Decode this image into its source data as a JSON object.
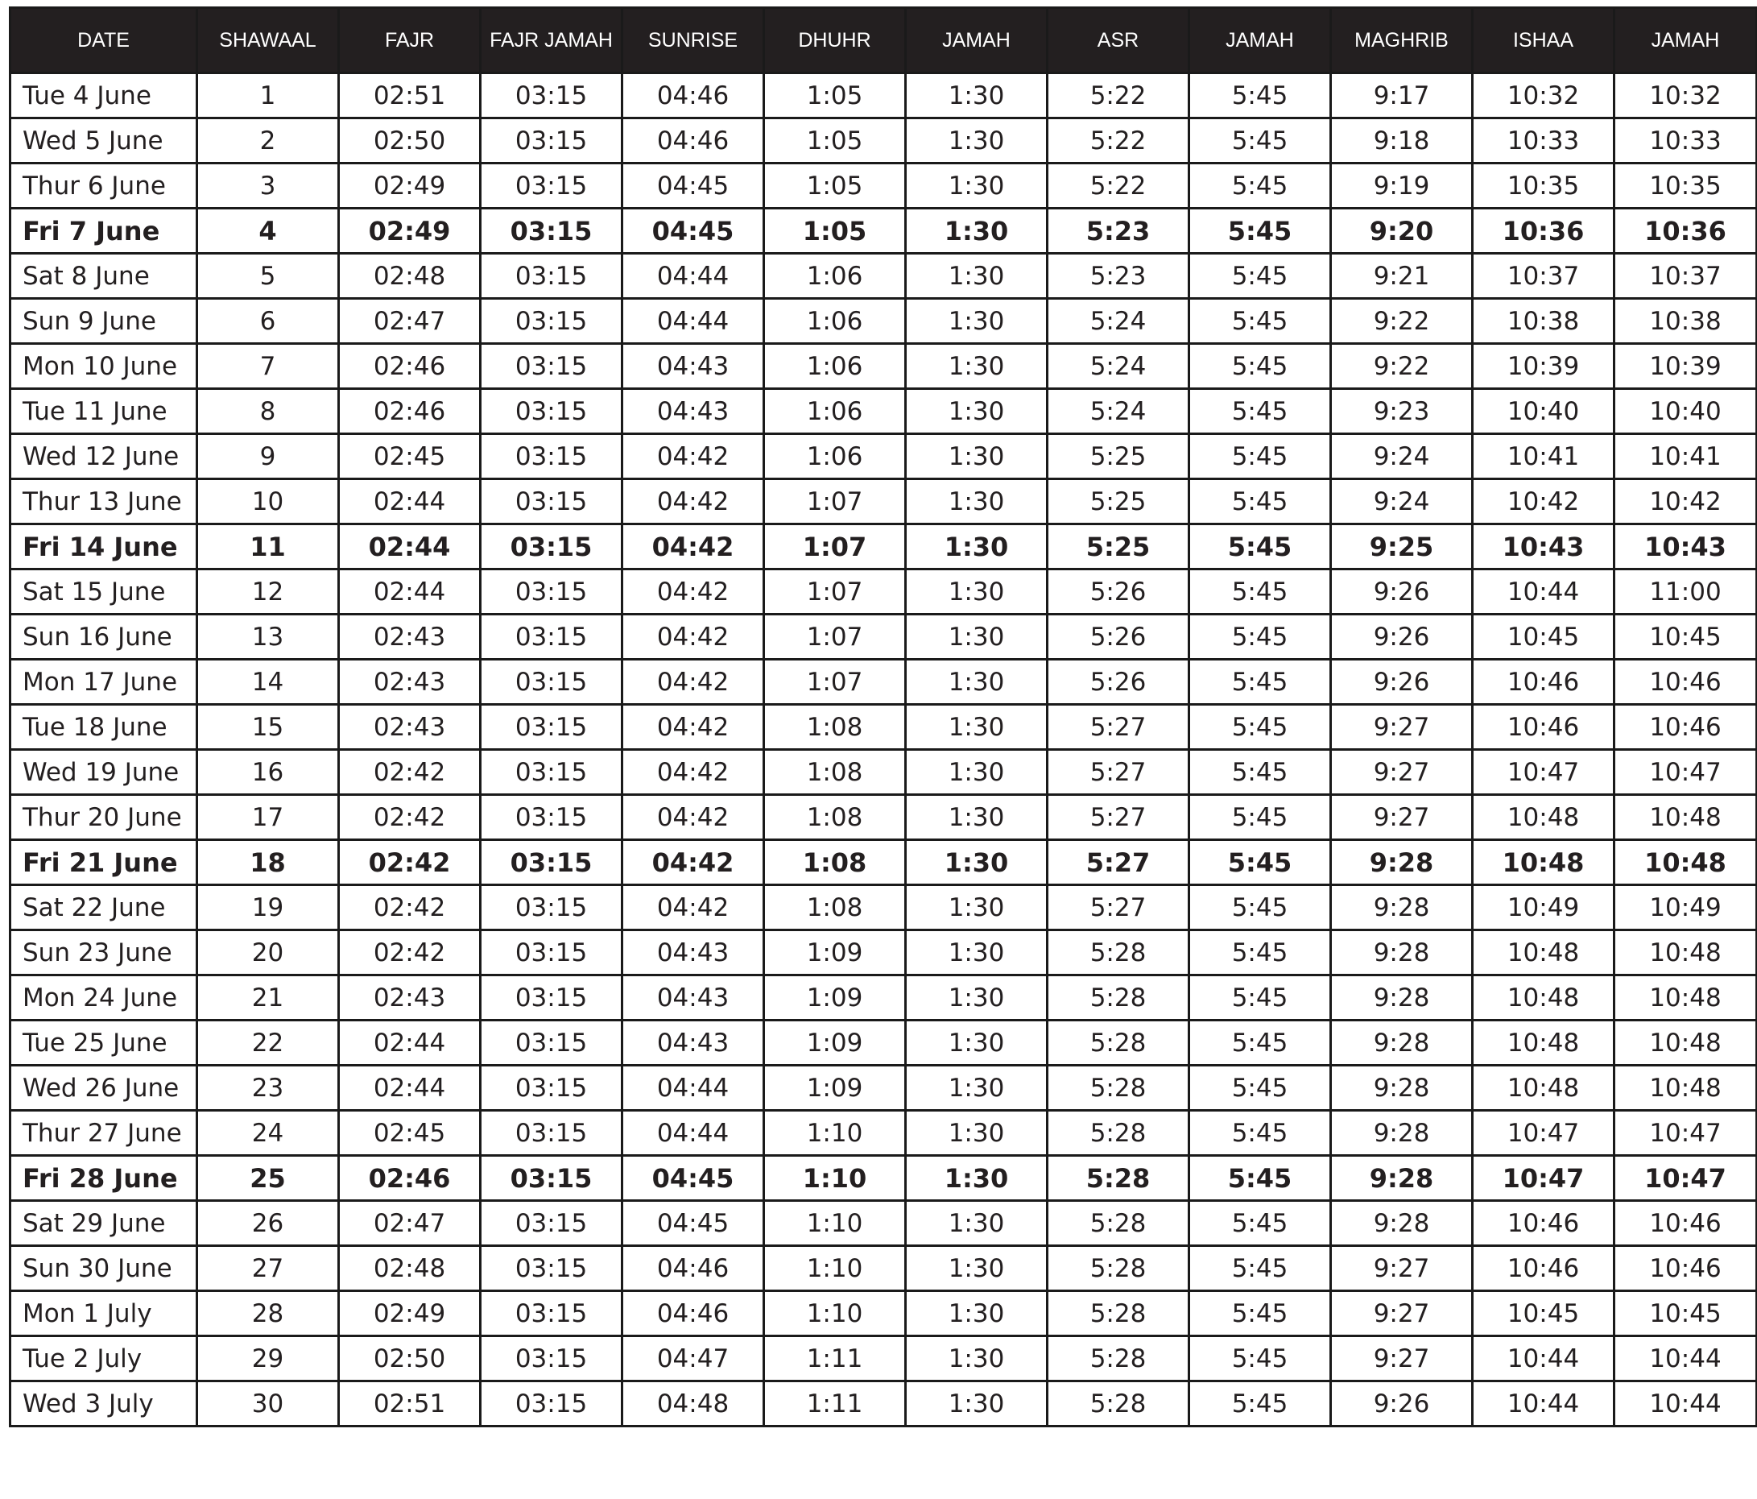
{
  "headers": [
    "DATE",
    "SHAWAAL",
    "FAJR",
    "FAJR JAMAH",
    "SUNRISE",
    "DHUHR",
    "JAMAH",
    "ASR",
    "JAMAH",
    "MAGHRIB",
    "ISHAA",
    "JAMAH"
  ],
  "rows": [
    {
      "date": "Tue 4 June",
      "shawaal": "1",
      "fajr": "02:51",
      "fajr_jamah": "03:15",
      "sunrise": "04:46",
      "dhuhr": "1:05",
      "dhuhr_jamah": "1:30",
      "asr": "5:22",
      "asr_jamah": "5:45",
      "maghrib": "9:17",
      "ishaa": "10:32",
      "ishaa_jamah": "10:32",
      "friday": false
    },
    {
      "date": "Wed 5 June",
      "shawaal": "2",
      "fajr": "02:50",
      "fajr_jamah": "03:15",
      "sunrise": "04:46",
      "dhuhr": "1:05",
      "dhuhr_jamah": "1:30",
      "asr": "5:22",
      "asr_jamah": "5:45",
      "maghrib": "9:18",
      "ishaa": "10:33",
      "ishaa_jamah": "10:33",
      "friday": false
    },
    {
      "date": "Thur 6 June",
      "shawaal": "3",
      "fajr": "02:49",
      "fajr_jamah": "03:15",
      "sunrise": "04:45",
      "dhuhr": "1:05",
      "dhuhr_jamah": "1:30",
      "asr": "5:22",
      "asr_jamah": "5:45",
      "maghrib": "9:19",
      "ishaa": "10:35",
      "ishaa_jamah": "10:35",
      "friday": false
    },
    {
      "date": "Fri 7 June",
      "shawaal": "4",
      "fajr": "02:49",
      "fajr_jamah": "03:15",
      "sunrise": "04:45",
      "dhuhr": "1:05",
      "dhuhr_jamah": "1:30",
      "asr": "5:23",
      "asr_jamah": "5:45",
      "maghrib": "9:20",
      "ishaa": "10:36",
      "ishaa_jamah": "10:36",
      "friday": true
    },
    {
      "date": "Sat 8 June",
      "shawaal": "5",
      "fajr": "02:48",
      "fajr_jamah": "03:15",
      "sunrise": "04:44",
      "dhuhr": "1:06",
      "dhuhr_jamah": "1:30",
      "asr": "5:23",
      "asr_jamah": "5:45",
      "maghrib": "9:21",
      "ishaa": "10:37",
      "ishaa_jamah": "10:37",
      "friday": false
    },
    {
      "date": "Sun 9 June",
      "shawaal": "6",
      "fajr": "02:47",
      "fajr_jamah": "03:15",
      "sunrise": "04:44",
      "dhuhr": "1:06",
      "dhuhr_jamah": "1:30",
      "asr": "5:24",
      "asr_jamah": "5:45",
      "maghrib": "9:22",
      "ishaa": "10:38",
      "ishaa_jamah": "10:38",
      "friday": false
    },
    {
      "date": "Mon 10 June",
      "shawaal": "7",
      "fajr": "02:46",
      "fajr_jamah": "03:15",
      "sunrise": "04:43",
      "dhuhr": "1:06",
      "dhuhr_jamah": "1:30",
      "asr": "5:24",
      "asr_jamah": "5:45",
      "maghrib": "9:22",
      "ishaa": "10:39",
      "ishaa_jamah": "10:39",
      "friday": false
    },
    {
      "date": "Tue 11 June",
      "shawaal": "8",
      "fajr": "02:46",
      "fajr_jamah": "03:15",
      "sunrise": "04:43",
      "dhuhr": "1:06",
      "dhuhr_jamah": "1:30",
      "asr": "5:24",
      "asr_jamah": "5:45",
      "maghrib": "9:23",
      "ishaa": "10:40",
      "ishaa_jamah": "10:40",
      "friday": false
    },
    {
      "date": "Wed 12 June",
      "shawaal": "9",
      "fajr": "02:45",
      "fajr_jamah": "03:15",
      "sunrise": "04:42",
      "dhuhr": "1:06",
      "dhuhr_jamah": "1:30",
      "asr": "5:25",
      "asr_jamah": "5:45",
      "maghrib": "9:24",
      "ishaa": "10:41",
      "ishaa_jamah": "10:41",
      "friday": false
    },
    {
      "date": "Thur 13 June",
      "shawaal": "10",
      "fajr": "02:44",
      "fajr_jamah": "03:15",
      "sunrise": "04:42",
      "dhuhr": "1:07",
      "dhuhr_jamah": "1:30",
      "asr": "5:25",
      "asr_jamah": "5:45",
      "maghrib": "9:24",
      "ishaa": "10:42",
      "ishaa_jamah": "10:42",
      "friday": false
    },
    {
      "date": "Fri 14 June",
      "shawaal": "11",
      "fajr": "02:44",
      "fajr_jamah": "03:15",
      "sunrise": "04:42",
      "dhuhr": "1:07",
      "dhuhr_jamah": "1:30",
      "asr": "5:25",
      "asr_jamah": "5:45",
      "maghrib": "9:25",
      "ishaa": "10:43",
      "ishaa_jamah": "10:43",
      "friday": true
    },
    {
      "date": "Sat 15 June",
      "shawaal": "12",
      "fajr": "02:44",
      "fajr_jamah": "03:15",
      "sunrise": "04:42",
      "dhuhr": "1:07",
      "dhuhr_jamah": "1:30",
      "asr": "5:26",
      "asr_jamah": "5:45",
      "maghrib": "9:26",
      "ishaa": "10:44",
      "ishaa_jamah": "11:00",
      "friday": false
    },
    {
      "date": "Sun 16 June",
      "shawaal": "13",
      "fajr": "02:43",
      "fajr_jamah": "03:15",
      "sunrise": "04:42",
      "dhuhr": "1:07",
      "dhuhr_jamah": "1:30",
      "asr": "5:26",
      "asr_jamah": "5:45",
      "maghrib": "9:26",
      "ishaa": "10:45",
      "ishaa_jamah": "10:45",
      "friday": false
    },
    {
      "date": "Mon 17 June",
      "shawaal": "14",
      "fajr": "02:43",
      "fajr_jamah": "03:15",
      "sunrise": "04:42",
      "dhuhr": "1:07",
      "dhuhr_jamah": "1:30",
      "asr": "5:26",
      "asr_jamah": "5:45",
      "maghrib": "9:26",
      "ishaa": "10:46",
      "ishaa_jamah": "10:46",
      "friday": false
    },
    {
      "date": "Tue 18 June",
      "shawaal": "15",
      "fajr": "02:43",
      "fajr_jamah": "03:15",
      "sunrise": "04:42",
      "dhuhr": "1:08",
      "dhuhr_jamah": "1:30",
      "asr": "5:27",
      "asr_jamah": "5:45",
      "maghrib": "9:27",
      "ishaa": "10:46",
      "ishaa_jamah": "10:46",
      "friday": false
    },
    {
      "date": "Wed 19 June",
      "shawaal": "16",
      "fajr": "02:42",
      "fajr_jamah": "03:15",
      "sunrise": "04:42",
      "dhuhr": "1:08",
      "dhuhr_jamah": "1:30",
      "asr": "5:27",
      "asr_jamah": "5:45",
      "maghrib": "9:27",
      "ishaa": "10:47",
      "ishaa_jamah": "10:47",
      "friday": false
    },
    {
      "date": "Thur 20 June",
      "shawaal": "17",
      "fajr": "02:42",
      "fajr_jamah": "03:15",
      "sunrise": "04:42",
      "dhuhr": "1:08",
      "dhuhr_jamah": "1:30",
      "asr": "5:27",
      "asr_jamah": "5:45",
      "maghrib": "9:27",
      "ishaa": "10:48",
      "ishaa_jamah": "10:48",
      "friday": false
    },
    {
      "date": "Fri 21 June",
      "shawaal": "18",
      "fajr": "02:42",
      "fajr_jamah": "03:15",
      "sunrise": "04:42",
      "dhuhr": "1:08",
      "dhuhr_jamah": "1:30",
      "asr": "5:27",
      "asr_jamah": "5:45",
      "maghrib": "9:28",
      "ishaa": "10:48",
      "ishaa_jamah": "10:48",
      "friday": true
    },
    {
      "date": "Sat 22 June",
      "shawaal": "19",
      "fajr": "02:42",
      "fajr_jamah": "03:15",
      "sunrise": "04:42",
      "dhuhr": "1:08",
      "dhuhr_jamah": "1:30",
      "asr": "5:27",
      "asr_jamah": "5:45",
      "maghrib": "9:28",
      "ishaa": "10:49",
      "ishaa_jamah": "10:49",
      "friday": false
    },
    {
      "date": "Sun 23 June",
      "shawaal": "20",
      "fajr": "02:42",
      "fajr_jamah": "03:15",
      "sunrise": "04:43",
      "dhuhr": "1:09",
      "dhuhr_jamah": "1:30",
      "asr": "5:28",
      "asr_jamah": "5:45",
      "maghrib": "9:28",
      "ishaa": "10:48",
      "ishaa_jamah": "10:48",
      "friday": false
    },
    {
      "date": "Mon 24 June",
      "shawaal": "21",
      "fajr": "02:43",
      "fajr_jamah": "03:15",
      "sunrise": "04:43",
      "dhuhr": "1:09",
      "dhuhr_jamah": "1:30",
      "asr": "5:28",
      "asr_jamah": "5:45",
      "maghrib": "9:28",
      "ishaa": "10:48",
      "ishaa_jamah": "10:48",
      "friday": false
    },
    {
      "date": "Tue 25 June",
      "shawaal": "22",
      "fajr": "02:44",
      "fajr_jamah": "03:15",
      "sunrise": "04:43",
      "dhuhr": "1:09",
      "dhuhr_jamah": "1:30",
      "asr": "5:28",
      "asr_jamah": "5:45",
      "maghrib": "9:28",
      "ishaa": "10:48",
      "ishaa_jamah": "10:48",
      "friday": false
    },
    {
      "date": "Wed 26 June",
      "shawaal": "23",
      "fajr": "02:44",
      "fajr_jamah": "03:15",
      "sunrise": "04:44",
      "dhuhr": "1:09",
      "dhuhr_jamah": "1:30",
      "asr": "5:28",
      "asr_jamah": "5:45",
      "maghrib": "9:28",
      "ishaa": "10:48",
      "ishaa_jamah": "10:48",
      "friday": false
    },
    {
      "date": "Thur 27 June",
      "shawaal": "24",
      "fajr": "02:45",
      "fajr_jamah": "03:15",
      "sunrise": "04:44",
      "dhuhr": "1:10",
      "dhuhr_jamah": "1:30",
      "asr": "5:28",
      "asr_jamah": "5:45",
      "maghrib": "9:28",
      "ishaa": "10:47",
      "ishaa_jamah": "10:47",
      "friday": false
    },
    {
      "date": "Fri 28 June",
      "shawaal": "25",
      "fajr": "02:46",
      "fajr_jamah": "03:15",
      "sunrise": "04:45",
      "dhuhr": "1:10",
      "dhuhr_jamah": "1:30",
      "asr": "5:28",
      "asr_jamah": "5:45",
      "maghrib": "9:28",
      "ishaa": "10:47",
      "ishaa_jamah": "10:47",
      "friday": true
    },
    {
      "date": "Sat 29 June",
      "shawaal": "26",
      "fajr": "02:47",
      "fajr_jamah": "03:15",
      "sunrise": "04:45",
      "dhuhr": "1:10",
      "dhuhr_jamah": "1:30",
      "asr": "5:28",
      "asr_jamah": "5:45",
      "maghrib": "9:28",
      "ishaa": "10:46",
      "ishaa_jamah": "10:46",
      "friday": false
    },
    {
      "date": "Sun 30 June",
      "shawaal": "27",
      "fajr": "02:48",
      "fajr_jamah": "03:15",
      "sunrise": "04:46",
      "dhuhr": "1:10",
      "dhuhr_jamah": "1:30",
      "asr": "5:28",
      "asr_jamah": "5:45",
      "maghrib": "9:27",
      "ishaa": "10:46",
      "ishaa_jamah": "10:46",
      "friday": false
    },
    {
      "date": "Mon 1 July",
      "shawaal": "28",
      "fajr": "02:49",
      "fajr_jamah": "03:15",
      "sunrise": "04:46",
      "dhuhr": "1:10",
      "dhuhr_jamah": "1:30",
      "asr": "5:28",
      "asr_jamah": "5:45",
      "maghrib": "9:27",
      "ishaa": "10:45",
      "ishaa_jamah": "10:45",
      "friday": false
    },
    {
      "date": "Tue 2 July",
      "shawaal": "29",
      "fajr": "02:50",
      "fajr_jamah": "03:15",
      "sunrise": "04:47",
      "dhuhr": "1:11",
      "dhuhr_jamah": "1:30",
      "asr": "5:28",
      "asr_jamah": "5:45",
      "maghrib": "9:27",
      "ishaa": "10:44",
      "ishaa_jamah": "10:44",
      "friday": false
    },
    {
      "date": "Wed 3 July",
      "shawaal": "30",
      "fajr": "02:51",
      "fajr_jamah": "03:15",
      "sunrise": "04:48",
      "dhuhr": "1:11",
      "dhuhr_jamah": "1:30",
      "asr": "5:28",
      "asr_jamah": "5:45",
      "maghrib": "9:26",
      "ishaa": "10:44",
      "ishaa_jamah": "10:44",
      "friday": false
    }
  ]
}
